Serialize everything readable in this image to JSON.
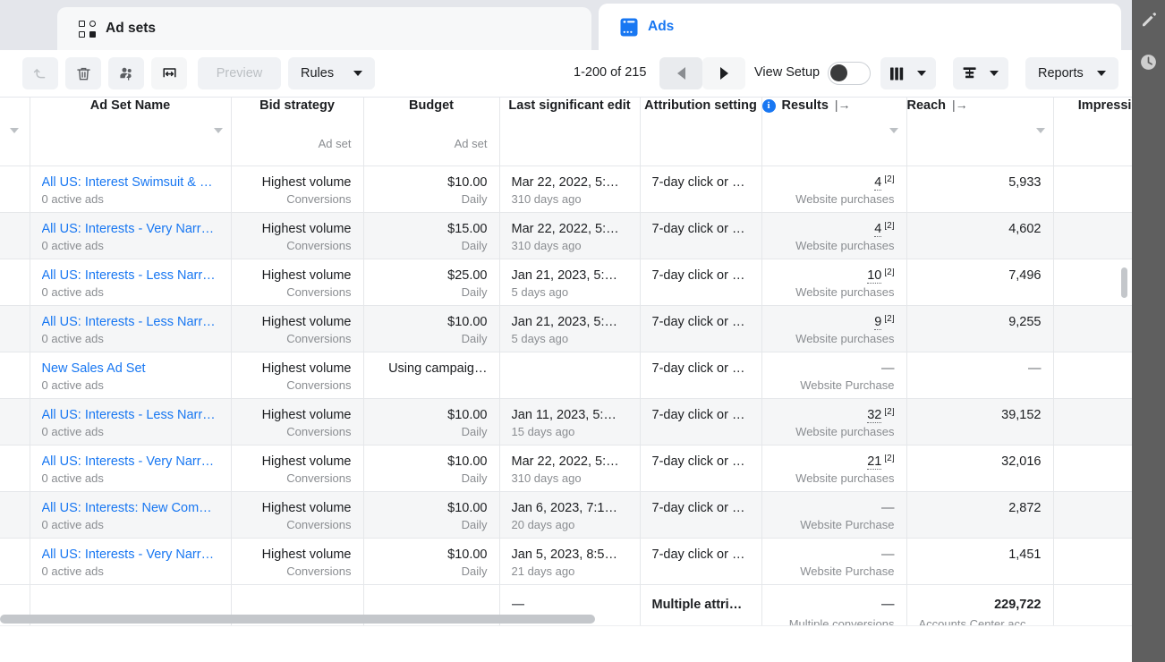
{
  "tabs": [
    {
      "id": "ad-sets",
      "label": "Ad sets",
      "icon": "grid-icon",
      "active": false
    },
    {
      "id": "ads",
      "label": "Ads",
      "icon": "ads-card-icon",
      "active": true
    }
  ],
  "toolbar": {
    "undo_label": "Undo",
    "delete_label": "Delete",
    "audience_label": "Audience",
    "abtest_label": "A/B test",
    "preview_label": "Preview",
    "rules_label": "Rules",
    "pagination": "1-200 of 215",
    "prev_label": "Previous page",
    "next_label": "Next page",
    "view_setup_label": "View Setup",
    "view_setup_on": true,
    "columns_label": "Columns",
    "breakdown_label": "Breakdown",
    "reports_label": "Reports"
  },
  "colors": {
    "link": "#1877f2",
    "tab_active_text": "#1877f2",
    "muted": "#8a8d91",
    "row_alt": "#f5f6f7",
    "rail": "#5f5f5f"
  },
  "table": {
    "columns": [
      {
        "key": "check",
        "header": "",
        "sub": "",
        "sortable": true
      },
      {
        "key": "name",
        "header": "Ad Set Name",
        "sub": "",
        "sortable": true
      },
      {
        "key": "bid",
        "header": "Bid strategy",
        "sub": "Ad set",
        "sortable": false
      },
      {
        "key": "budget",
        "header": "Budget",
        "sub": "Ad set",
        "sortable": false
      },
      {
        "key": "edit",
        "header": "Last significant edit",
        "sub": "",
        "sortable": false
      },
      {
        "key": "attr",
        "header": "Attribution setting",
        "sub": "",
        "sortable": false
      },
      {
        "key": "results",
        "header": "Results",
        "sub": "",
        "sortable": true,
        "info": true,
        "pin": "|→"
      },
      {
        "key": "reach",
        "header": "Reach",
        "sub": "",
        "sortable": true,
        "pin": "|→"
      },
      {
        "key": "imp",
        "header": "Impressions",
        "sub": "",
        "sortable": false
      }
    ],
    "rows": [
      {
        "name": "All US: Interest Swimsuit & …",
        "name_sub": "0 active ads",
        "bid": "Highest volume",
        "bid_sub": "Conversions",
        "budget": "$10.00",
        "budget_sub": "Daily",
        "edit": "Mar 22, 2022, 5:…",
        "edit_sub": "310 days ago",
        "attr": "7-day click or …",
        "results": "4",
        "results_fn": "[2]",
        "results_sub": "Website purchases",
        "reach": "5,933",
        "imp": ""
      },
      {
        "name": "All US: Interests - Very Narr…",
        "name_sub": "0 active ads",
        "bid": "Highest volume",
        "bid_sub": "Conversions",
        "budget": "$15.00",
        "budget_sub": "Daily",
        "edit": "Mar 22, 2022, 5:…",
        "edit_sub": "310 days ago",
        "attr": "7-day click or …",
        "results": "4",
        "results_fn": "[2]",
        "results_sub": "Website purchases",
        "reach": "4,602",
        "imp": ""
      },
      {
        "name": "All US: Interests - Less Narr…",
        "name_sub": "0 active ads",
        "bid": "Highest volume",
        "bid_sub": "Conversions",
        "budget": "$25.00",
        "budget_sub": "Daily",
        "edit": "Jan 21, 2023, 5:…",
        "edit_sub": "5 days ago",
        "attr": "7-day click or …",
        "results": "10",
        "results_fn": "[2]",
        "results_sub": "Website purchases",
        "reach": "7,496",
        "imp": ""
      },
      {
        "name": "All US: Interests - Less Narr…",
        "name_sub": "0 active ads",
        "bid": "Highest volume",
        "bid_sub": "Conversions",
        "budget": "$10.00",
        "budget_sub": "Daily",
        "edit": "Jan 21, 2023, 5:…",
        "edit_sub": "5 days ago",
        "attr": "7-day click or …",
        "results": "9",
        "results_fn": "[2]",
        "results_sub": "Website purchases",
        "reach": "9,255",
        "imp": ""
      },
      {
        "name": "New Sales Ad Set",
        "name_sub": "0 active ads",
        "bid": "Highest volume",
        "bid_sub": "Conversions",
        "budget": "Using campaig…",
        "budget_sub": "",
        "edit": "",
        "edit_sub": "",
        "attr": "7-day click or …",
        "results": "—",
        "results_fn": "",
        "results_sub": "Website Purchase",
        "reach": "—",
        "imp": ""
      },
      {
        "name": "All US: Interests - Less Narr…",
        "name_sub": "0 active ads",
        "bid": "Highest volume",
        "bid_sub": "Conversions",
        "budget": "$10.00",
        "budget_sub": "Daily",
        "edit": "Jan 11, 2023, 5:…",
        "edit_sub": "15 days ago",
        "attr": "7-day click or …",
        "results": "32",
        "results_fn": "[2]",
        "results_sub": "Website purchases",
        "reach": "39,152",
        "imp": ""
      },
      {
        "name": "All US: Interests - Very Narr…",
        "name_sub": "0 active ads",
        "bid": "Highest volume",
        "bid_sub": "Conversions",
        "budget": "$10.00",
        "budget_sub": "Daily",
        "edit": "Mar 22, 2022, 5:…",
        "edit_sub": "310 days ago",
        "attr": "7-day click or …",
        "results": "21",
        "results_fn": "[2]",
        "results_sub": "Website purchases",
        "reach": "32,016",
        "imp": ""
      },
      {
        "name": "All US: Interests: New Com…",
        "name_sub": "0 active ads",
        "bid": "Highest volume",
        "bid_sub": "Conversions",
        "budget": "$10.00",
        "budget_sub": "Daily",
        "edit": "Jan 6, 2023, 7:1…",
        "edit_sub": "20 days ago",
        "attr": "7-day click or …",
        "results": "—",
        "results_fn": "",
        "results_sub": "Website Purchase",
        "reach": "2,872",
        "imp": ""
      },
      {
        "name": "All US: Interests - Very Narr…",
        "name_sub": "0 active ads",
        "bid": "Highest volume",
        "bid_sub": "Conversions",
        "budget": "$10.00",
        "budget_sub": "Daily",
        "edit": "Jan 5, 2023, 8:5…",
        "edit_sub": "21 days ago",
        "attr": "7-day click or …",
        "results": "—",
        "results_fn": "",
        "results_sub": "Website Purchase",
        "reach": "1,451",
        "imp": ""
      }
    ],
    "totals": {
      "name": "",
      "name_sub": "",
      "bid": "",
      "bid_sub": "",
      "budget": "",
      "budget_sub": "",
      "edit": "—",
      "edit_sub": "",
      "attr": "Multiple attrib…",
      "results": "—",
      "results_sub": "Multiple conversions",
      "reach": "229,722",
      "reach_sub": "Accounts Center acco…",
      "imp": "",
      "imp_sub": ""
    }
  },
  "rail": {
    "pencil_label": "Edit",
    "clock_label": "History"
  }
}
